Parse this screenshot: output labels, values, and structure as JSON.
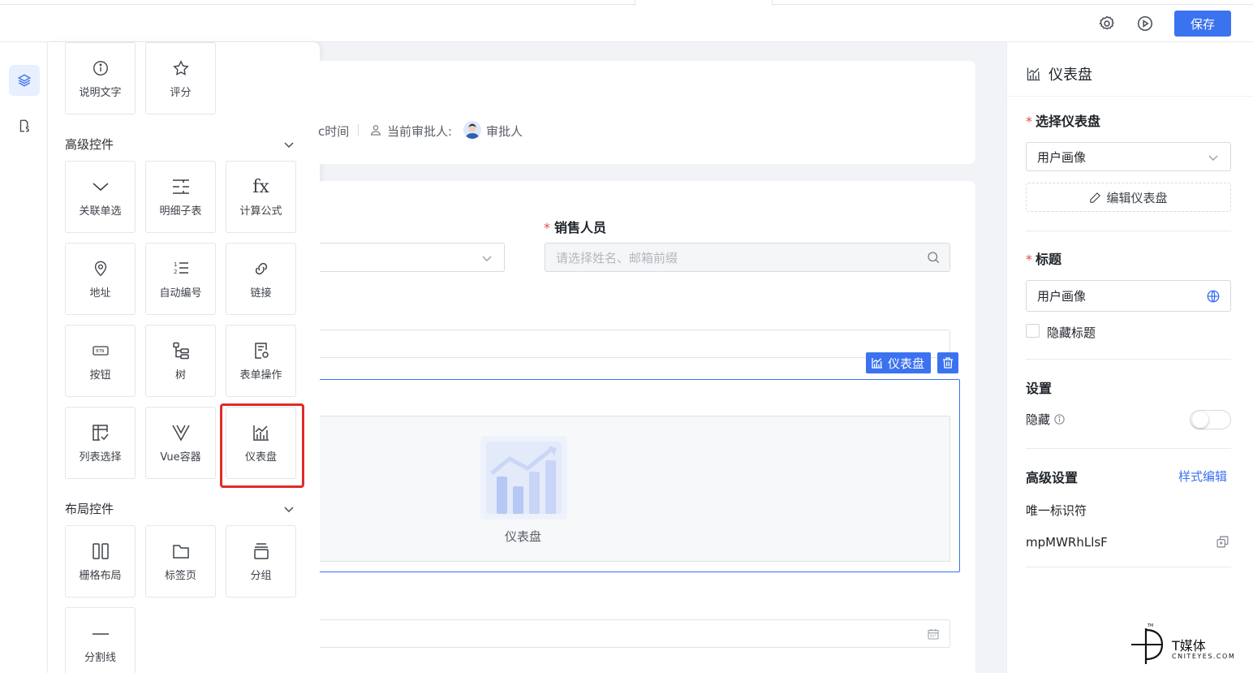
{
  "topbar": {
    "save_label": "保存",
    "icons": [
      "gear-icon",
      "play-circle-icon"
    ]
  },
  "rail": {
    "items": [
      "layers-icon",
      "document-icon"
    ]
  },
  "palette": {
    "basic_tiles": [
      {
        "label": "说明文字",
        "icon": "info-icon"
      },
      {
        "label": "评分",
        "icon": "star-icon"
      }
    ],
    "advanced_section": "高级控件",
    "advanced_tiles": [
      {
        "label": "关联单选",
        "icon": "chevron-down-icon"
      },
      {
        "label": "明细子表",
        "icon": "table-lines-icon"
      },
      {
        "label": "计算公式",
        "icon": "fx-icon"
      },
      {
        "label": "地址",
        "icon": "location-icon"
      },
      {
        "label": "自动编号",
        "icon": "numbered-list-icon"
      },
      {
        "label": "链接",
        "icon": "link-icon"
      },
      {
        "label": "按钮",
        "icon": "button-icon"
      },
      {
        "label": "树",
        "icon": "tree-icon"
      },
      {
        "label": "表单操作",
        "icon": "form-settings-icon"
      },
      {
        "label": "列表选择",
        "icon": "list-select-icon"
      },
      {
        "label": "Vue容器",
        "icon": "vue-icon"
      },
      {
        "label": "仪表盘",
        "icon": "dashboard-chart-icon"
      }
    ],
    "btn_glyph": "BTN",
    "fx_glyph": "fx",
    "list_nums": [
      "1",
      "2"
    ],
    "layout_section": "布局控件",
    "layout_tiles": [
      {
        "label": "栅格布局",
        "icon": "grid-columns-icon"
      },
      {
        "label": "标签页",
        "icon": "folder-tab-icon"
      },
      {
        "label": "分组",
        "icon": "group-icon"
      },
      {
        "label": "分割线",
        "icon": "divider-icon"
      }
    ]
  },
  "canvas": {
    "meta_time": "c时间",
    "approver_label": "当前审批人:",
    "approver_name": "审批人",
    "sales_label": "销售人员",
    "sales_placeholder": "请选择姓名、邮箱前缀",
    "selected_tag": "仪表盘",
    "widget_caption": "仪表盘"
  },
  "right_panel": {
    "header": "仪表盘",
    "select_dashboard_label": "选择仪表盘",
    "select_dashboard_value": "用户画像",
    "edit_dashboard": "编辑仪表盘",
    "title_label": "标题",
    "title_value": "用户画像",
    "hide_title": "隐藏标题",
    "settings_heading": "设置",
    "hidden_label": "隐藏",
    "hidden_toggle": false,
    "advanced_heading": "高级设置",
    "style_edit": "样式编辑",
    "uid_label": "唯一标识符",
    "uid_value": "mpMWRhLlsF"
  },
  "watermark": {
    "brand": "T媒体",
    "site": "CNITEYES.COM",
    "tm": "TM"
  },
  "colors": {
    "accent": "#3b72f0",
    "highlight": "#e12a2a",
    "required": "#e34d4d"
  }
}
